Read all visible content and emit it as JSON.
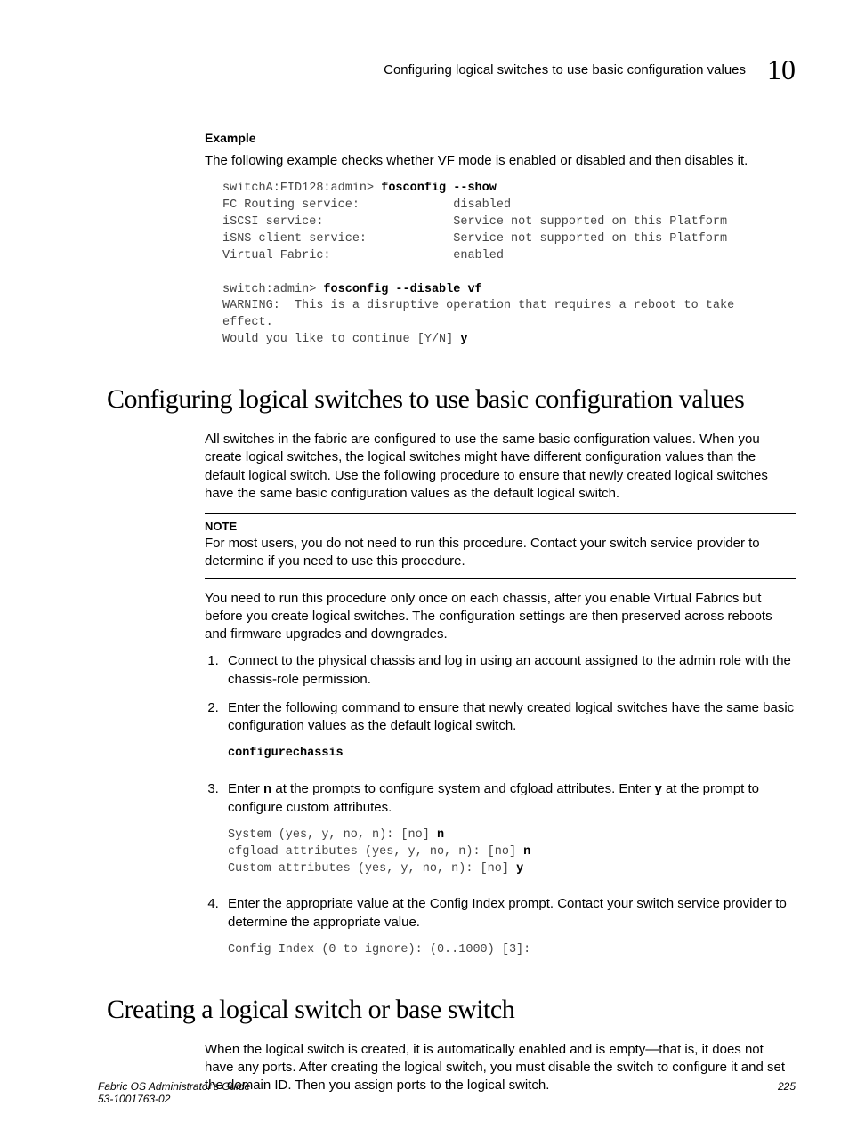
{
  "header": {
    "text": "Configuring logical switches to use basic configuration values",
    "chapter": "10"
  },
  "example": {
    "label": "Example",
    "intro": "The following example checks whether VF mode is enabled or disabled and then disables it.",
    "code_prompt1": "switchA:FID128:admin> ",
    "code_cmd1": "fosconfig --show",
    "code_output1": "FC Routing service:             disabled\niSCSI service:                  Service not supported on this Platform\niSNS client service:            Service not supported on this Platform\nVirtual Fabric:                 enabled",
    "code_prompt2": "switch:admin> ",
    "code_cmd2": "fosconfig --disable vf",
    "code_output2": "WARNING:  This is a disruptive operation that requires a reboot to take \neffect.\nWould you like to continue [Y/N] ",
    "code_input2": "y"
  },
  "section1": {
    "heading": "Configuring logical switches to use basic configuration values",
    "para1": "All switches in the fabric are configured to use the same basic configuration values. When you create logical switches, the logical switches might have different configuration values than the default logical switch. Use the following procedure to ensure that newly created logical switches have the same basic configuration values as the default logical switch.",
    "note_label": "NOTE",
    "note_text": "For most users, you do not need to run this procedure. Contact your switch service provider to determine if you need to use this procedure.",
    "para2": "You need to run this procedure only once on each chassis, after you enable Virtual Fabrics but before you create logical switches. The configuration settings are then preserved across reboots and firmware upgrades and downgrades.",
    "step1": "Connect to the physical chassis and log in using an account assigned to the admin role with the chassis-role permission.",
    "step2": "Enter the following command to ensure that newly created logical switches have the same basic configuration values as the default logical switch.",
    "step2_cmd": "configurechassis",
    "step3_a": "Enter ",
    "step3_n": "n",
    "step3_b": " at the prompts to configure system and cfgload attributes. Enter ",
    "step3_y": "y",
    "step3_c": " at the prompt to configure custom attributes.",
    "step3_code_l1a": "System (yes, y, no, n): [no] ",
    "step3_code_l1b": "n",
    "step3_code_l2a": "cfgload attributes (yes, y, no, n): [no] ",
    "step3_code_l2b": "n",
    "step3_code_l3a": "Custom attributes (yes, y, no, n): [no] ",
    "step3_code_l3b": "y",
    "step4": "Enter the appropriate value at the Config Index prompt. Contact your switch service provider to determine the appropriate value.",
    "step4_code": "Config Index (0 to ignore): (0..1000) [3]:"
  },
  "section2": {
    "heading": "Creating a logical switch or base switch",
    "para1": "When the logical switch is created, it is automatically enabled and is empty—that is, it does not have any ports. After creating the logical switch, you must disable the switch to configure it and set the domain ID. Then you assign ports to the logical switch."
  },
  "footer": {
    "title": "Fabric OS Administrator's Guide",
    "docnum": "53-1001763-02",
    "page": "225"
  }
}
